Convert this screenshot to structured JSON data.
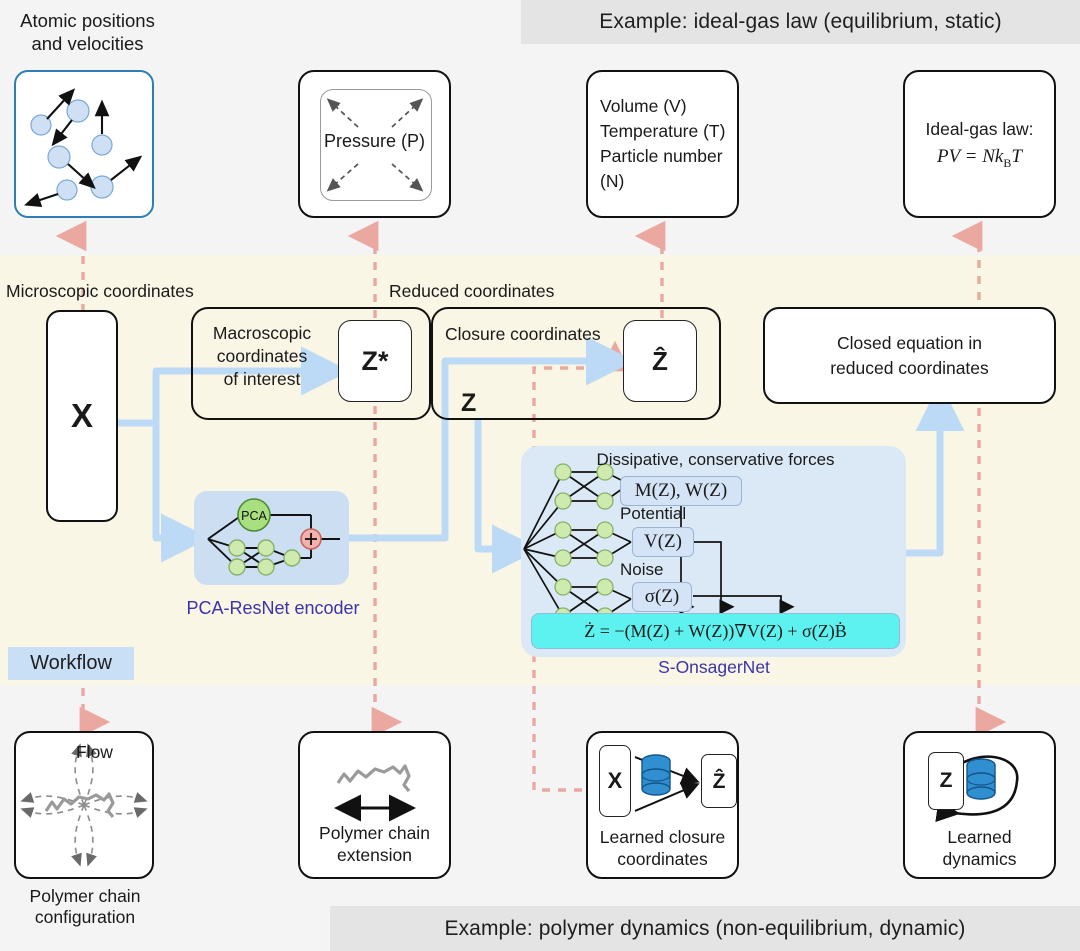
{
  "banners": {
    "top": "Example: ideal-gas law (equilibrium, static)",
    "bottom": "Example: polymer dynamics (non-equilibrium, dynamic)",
    "workflow": "Workflow"
  },
  "top_row": {
    "atoms": {
      "caption": "Atomic positions\nand velocities",
      "icon": "particles-with-velocity-arrows"
    },
    "pressure": {
      "label": "Pressure (P)",
      "icon": "outward-dashed-arrows"
    },
    "state_vars": {
      "lines": [
        "Volume (V)",
        "Temperature (T)",
        "Particle number",
        " (N)"
      ]
    },
    "ideal_gas": {
      "line1": "Ideal-gas law:",
      "line2": "PV = NkʙT",
      "line2_parts": {
        "pre": "PV = N",
        "k": "k",
        "sub": "B",
        "post": "T"
      }
    }
  },
  "workflow": {
    "labels": {
      "microscopic": "Microscopic coordinates",
      "reduced": "Reduced coordinates",
      "closure": "Closure coordinates",
      "macroscopic": "Macroscopic\ncoordinates\nof interest",
      "z": "Z"
    },
    "boxes": {
      "x": "X",
      "z_star": "Z*",
      "z_hat": "Ẑ",
      "closed_equation": "Closed equation in\nreduced coordinates"
    },
    "encoder": {
      "caption": "PCA-ResNet encoder",
      "pca_label": "PCA",
      "sum_label": "+"
    },
    "onsager": {
      "caption": "S-OnsagerNet",
      "title": "Dissipative, conservative forces",
      "potential_label": "Potential",
      "noise_label": "Noise",
      "chip_mw": "M(Z), W(Z)",
      "chip_v": "V(Z)",
      "chip_sigma": "σ(Z)",
      "equation": "Ż = −(M(Z) + W(Z))∇V(Z) + σ(Z)Ḃ"
    }
  },
  "bottom_row": {
    "polymer_config": {
      "caption": "Polymer chain\nconfiguration",
      "flow_label": "Flow"
    },
    "chain_extension": {
      "caption": "Polymer chain\nextension"
    },
    "learned_closure": {
      "caption": "Learned closure\ncoordinates",
      "x": "X",
      "z_hat": "Ẑ",
      "icon": "database-icon"
    },
    "learned_dynamics": {
      "caption": "Learned\ndynamics",
      "z": "Z",
      "icon": "database-icon"
    }
  },
  "colors": {
    "band_middle": "#faf6e6",
    "band_outer": "#f4f4f4",
    "banner_grey": "#e4e4e4",
    "workflow_tag": "#c9dff5",
    "flow_arrow_blue": "#bcd9f5",
    "dashed_pink": "#eaa8a0",
    "encoder_panel": "#ccdff2",
    "onsager_panel": "#dbe9f7",
    "equation_bar": "#5df2ef",
    "accent_purple": "#3b34a8",
    "atom_border": "#2b7fb5",
    "node_green": "#cfeaae",
    "pca_green": "#a8e07f",
    "sum_pink": "#f3b0ac",
    "database_blue": "#1f7fc4"
  }
}
